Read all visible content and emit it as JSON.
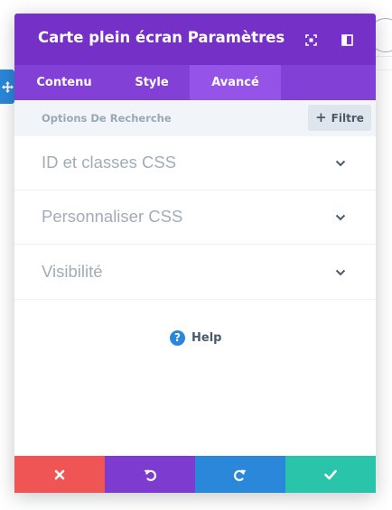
{
  "modal": {
    "title": "Carte plein écran Paramètres",
    "header_icons": [
      "fullscreen-icon",
      "sidebar-toggle-icon"
    ],
    "tabs": [
      {
        "label": "Contenu",
        "active": false
      },
      {
        "label": "Style",
        "active": false
      },
      {
        "label": "Avancé",
        "active": true
      }
    ],
    "search": {
      "placeholder": "Options De Recherche",
      "filter_label": "Filtre"
    },
    "sections": [
      {
        "label": "ID et classes CSS"
      },
      {
        "label": "Personnaliser CSS"
      },
      {
        "label": "Visibilité"
      }
    ],
    "help": {
      "icon": "?",
      "label": "Help"
    },
    "footer_buttons": [
      {
        "name": "cancel",
        "icon": "close-icon",
        "color": "#ef5555"
      },
      {
        "name": "undo",
        "icon": "undo-icon",
        "color": "#7e3bd0"
      },
      {
        "name": "redo",
        "icon": "redo-icon",
        "color": "#2b87da"
      },
      {
        "name": "save",
        "icon": "check-icon",
        "color": "#29c4a9"
      }
    ]
  },
  "colors": {
    "header": "#7531c7",
    "tabs": "#8340d7",
    "active_tab": "#9553e8",
    "accent_blue": "#2b87da"
  }
}
